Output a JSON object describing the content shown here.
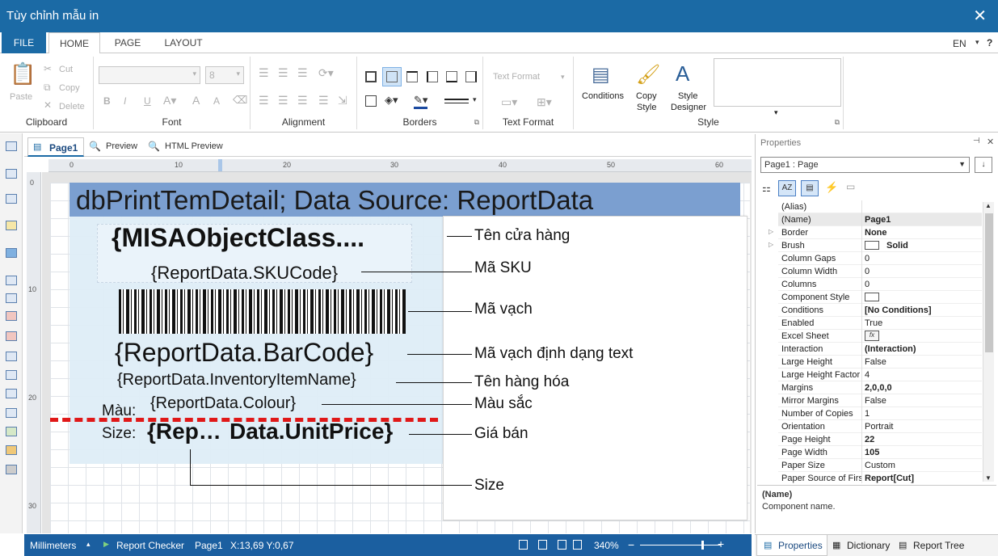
{
  "window": {
    "title": "Tùy chỉnh mẫu in"
  },
  "tabs": {
    "file": "FILE",
    "home": "HOME",
    "page": "PAGE",
    "layout": "LAYOUT",
    "lang": "EN",
    "help": "?"
  },
  "ribbon": {
    "clipboard": {
      "label": "Clipboard",
      "paste": "Paste",
      "cut": "Cut",
      "copy": "Copy",
      "delete": "Delete"
    },
    "font": {
      "label": "Font",
      "size": "8"
    },
    "alignment": {
      "label": "Alignment"
    },
    "borders": {
      "label": "Borders"
    },
    "text_format": {
      "label": "Text Format",
      "combo": "Text Format"
    },
    "style": {
      "label": "Style",
      "conditions": "Conditions",
      "copy_style_1": "Copy",
      "copy_style_2": "Style",
      "style_designer_1": "Style",
      "style_designer_2": "Designer"
    }
  },
  "doc_tabs": {
    "page1": "Page1",
    "preview": "Preview",
    "html_preview": "HTML Preview"
  },
  "ruler_h": [
    "0",
    "10",
    "20",
    "30",
    "40",
    "50",
    "60"
  ],
  "ruler_v": [
    "0",
    "10",
    "20",
    "30"
  ],
  "report": {
    "header_band": "dbPrintTemDetail; Data Source: ReportData",
    "f_store": "{MISAObjectClass....",
    "f_sku": "{ReportData.SKUCode}",
    "f_barcode_text": "{ReportData.BarCode}",
    "f_item": "{ReportData.InventoryItemName}",
    "f_colour": "{ReportData.Colour}",
    "lbl_colour": "Màu:",
    "lbl_size": "Size:",
    "f_size": "{Rep…",
    "f_price": "Data.UnitPrice}"
  },
  "annotations": {
    "store": "Tên cửa hàng",
    "sku": "Mã SKU",
    "barcode": "Mã vạch",
    "barcode_text": "Mã vạch định dạng text",
    "item": "Tên hàng hóa",
    "colour": "Màu sắc",
    "price": "Giá bán",
    "size": "Size"
  },
  "properties": {
    "title": "Properties",
    "selector": "Page1 : Page",
    "desc_title": "(Name)",
    "desc_text": "Component name.",
    "rows": [
      {
        "k": "(Alias)",
        "v": ""
      },
      {
        "k": "(Name)",
        "v": "Page1"
      },
      {
        "k": "Border",
        "v": "None"
      },
      {
        "k": "Brush",
        "v": "Solid"
      },
      {
        "k": "Column Gaps",
        "v": "0"
      },
      {
        "k": "Column Width",
        "v": "0"
      },
      {
        "k": "Columns",
        "v": "0"
      },
      {
        "k": "Component Style",
        "v": ""
      },
      {
        "k": "Conditions",
        "v": "[No Conditions]"
      },
      {
        "k": "Enabled",
        "v": "True"
      },
      {
        "k": "Excel Sheet",
        "v": ""
      },
      {
        "k": "Interaction",
        "v": "(Interaction)"
      },
      {
        "k": "Large Height",
        "v": "False"
      },
      {
        "k": "Large Height Factor",
        "v": "4"
      },
      {
        "k": "Margins",
        "v": "2,0,0,0"
      },
      {
        "k": "Mirror Margins",
        "v": "False"
      },
      {
        "k": "Number of Copies",
        "v": "1"
      },
      {
        "k": "Orientation",
        "v": "Portrait"
      },
      {
        "k": "Page Height",
        "v": "22"
      },
      {
        "k": "Page Width",
        "v": "105"
      },
      {
        "k": "Paper Size",
        "v": "Custom"
      },
      {
        "k": "Paper Source of Firs",
        "v": "Report[Cut]"
      }
    ]
  },
  "status": {
    "units": "Millimeters",
    "checker": "Report Checker",
    "page": "Page1",
    "coords": "X:13,69  Y:0,67",
    "zoom": "340%"
  },
  "bottom_tabs": {
    "properties": "Properties",
    "dictionary": "Dictionary",
    "report_tree": "Report Tree"
  }
}
